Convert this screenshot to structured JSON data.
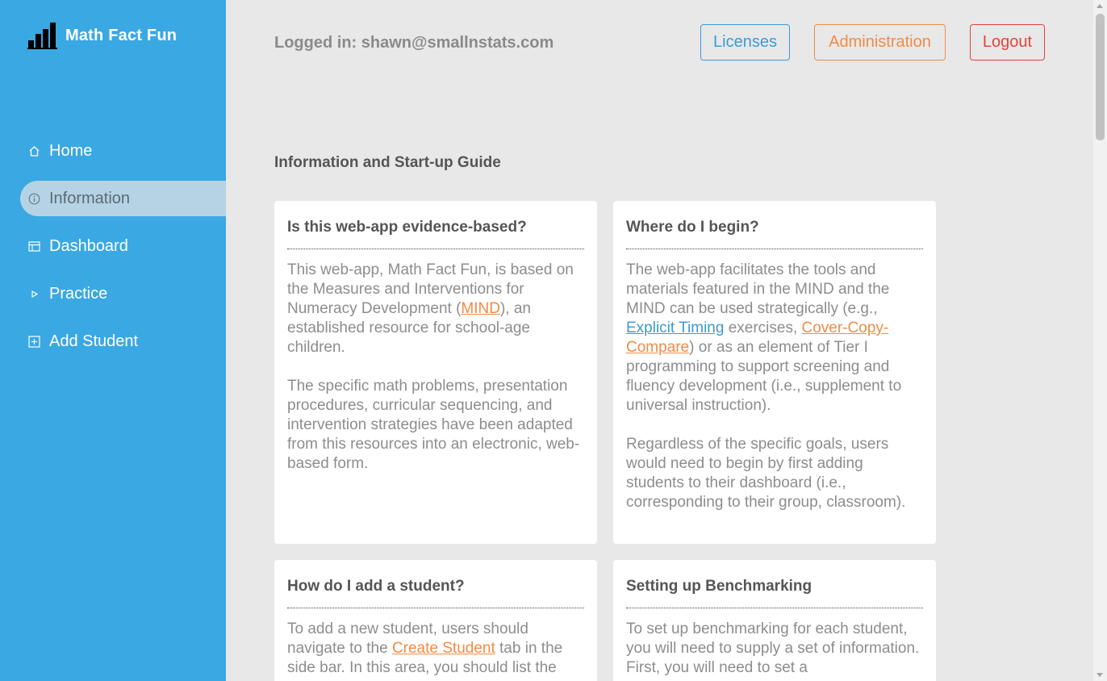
{
  "brand": {
    "name": "Math Fact Fun",
    "icon": "bar-chart-icon"
  },
  "sidebar": {
    "items": [
      {
        "label": "Home",
        "icon": "home-icon",
        "active": false
      },
      {
        "label": "Information",
        "icon": "info-icon",
        "active": true
      },
      {
        "label": "Dashboard",
        "icon": "dashboard-icon",
        "active": false
      },
      {
        "label": "Practice",
        "icon": "play-icon",
        "active": false
      },
      {
        "label": "Add Student",
        "icon": "plus-square-icon",
        "active": false
      }
    ]
  },
  "header": {
    "logged_in": "Logged in: shawn@smallnstats.com",
    "licenses_label": "Licenses",
    "administration_label": "Administration",
    "logout_label": "Logout"
  },
  "main": {
    "section_title": "Information and Start-up Guide",
    "cards": [
      {
        "title": "Is this web-app evidence-based?",
        "p1_a": "This web-app, Math Fact Fun, is based on the Measures and Interventions for Numeracy Development (",
        "p1_link": "MIND",
        "p1_b": "), an established resource for school-age children.",
        "p2": "The specific math problems, presentation procedures, curricular sequencing, and intervention strategies have been adapted from this resources into an electronic, web-based form."
      },
      {
        "title": "Where do I begin?",
        "p1_a": "The web-app facilitates the tools and materials featured in the MIND and the MIND can be used strategically (e.g., ",
        "p1_link1": "Explicit Timing",
        "p1_b": " exercises, ",
        "p1_link2": "Cover-Copy-Compare",
        "p1_c": ") or as an element of Tier I programming to support screening and fluency development (i.e., supplement to universal instruction).",
        "p2": "Regardless of the specific goals, users would need to begin by first adding students to their dashboard (i.e., corresponding to their group, classroom)."
      },
      {
        "title": "How do I add a student?",
        "p1_a": "To add a new student, users should navigate to the ",
        "p1_link": "Create Student",
        "p1_b": " tab in the side bar. In this area, you should list the"
      },
      {
        "title": "Setting up Benchmarking",
        "p1": "To set up benchmarking for each student, you will need to supply a set of information. First, you will need to set a"
      }
    ]
  },
  "colors": {
    "sidebar": "#3aa8e2",
    "background": "#e8e8e8",
    "link_orange": "#f08c46",
    "link_blue": "#3a9bd5",
    "logout_red": "#e0453a"
  }
}
